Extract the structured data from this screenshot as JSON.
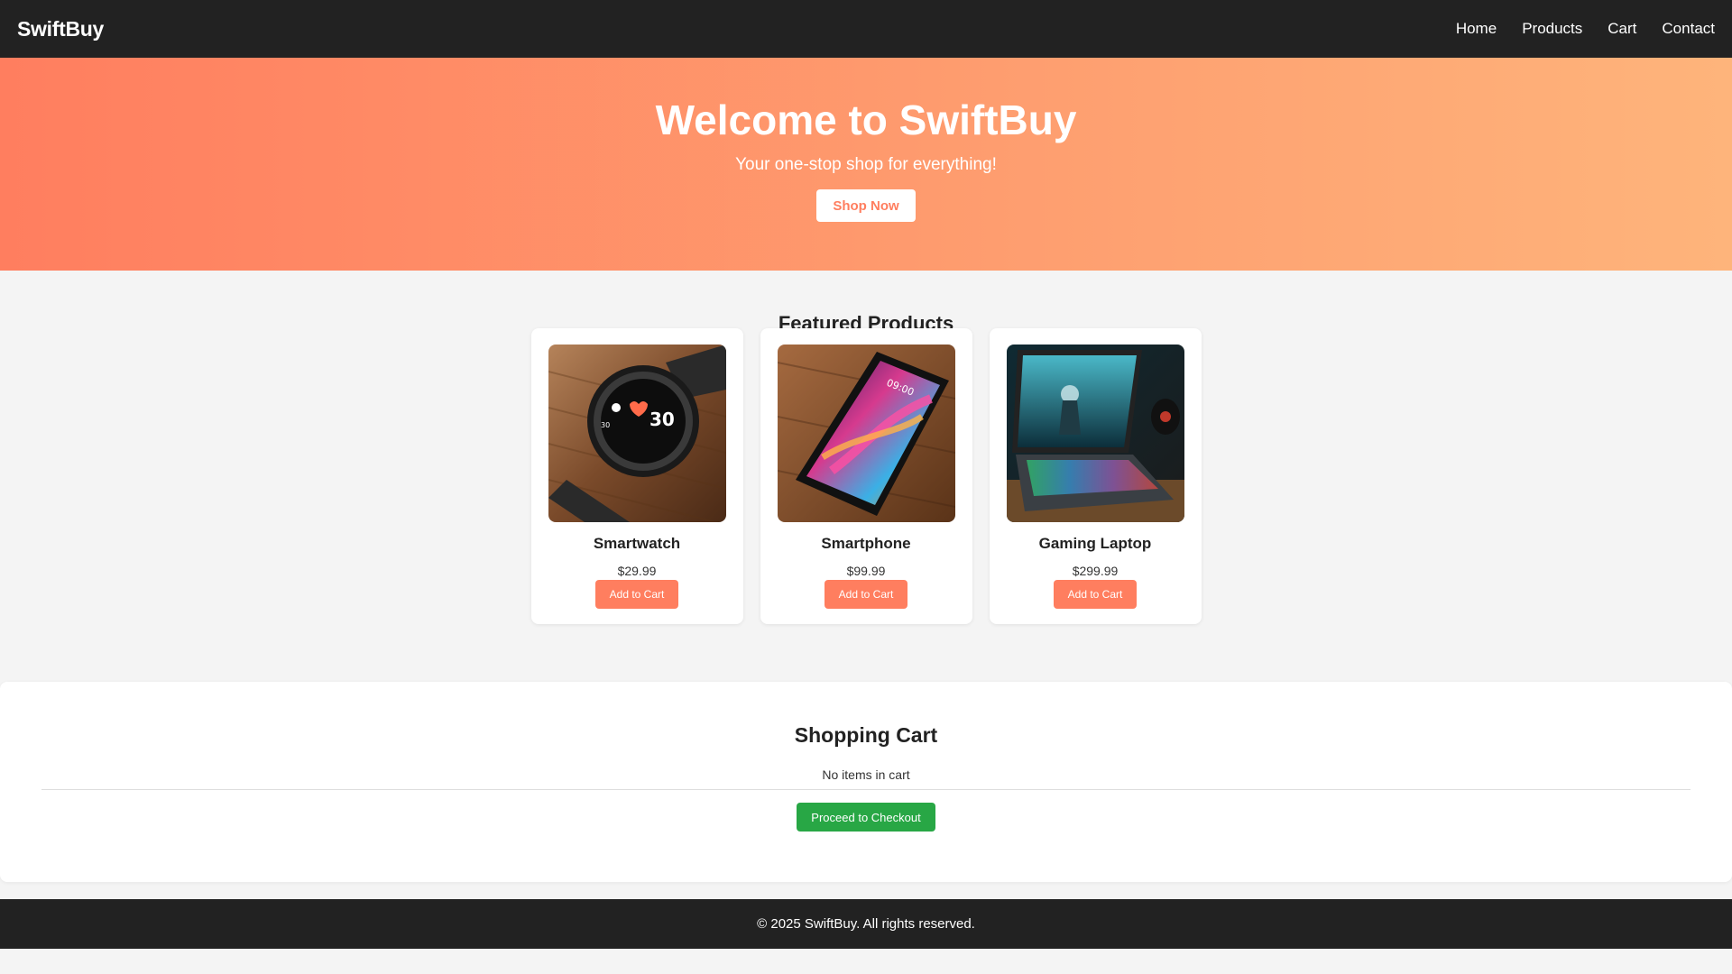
{
  "navbar": {
    "logo": "SwiftBuy",
    "links": [
      {
        "label": "Home"
      },
      {
        "label": "Products"
      },
      {
        "label": "Cart"
      },
      {
        "label": "Contact"
      }
    ]
  },
  "hero": {
    "title": "Welcome to SwiftBuy",
    "subtitle": "Your one-stop shop for everything!",
    "button_label": "Shop Now"
  },
  "products": {
    "title": "Featured Products",
    "items": [
      {
        "name": "Smartwatch",
        "price": "$29.99",
        "button_label": "Add to Cart",
        "image": "smartwatch-image"
      },
      {
        "name": "Smartphone",
        "price": "$99.99",
        "button_label": "Add to Cart",
        "image": "smartphone-image"
      },
      {
        "name": "Gaming Laptop",
        "price": "$299.99",
        "button_label": "Add to Cart",
        "image": "gaming-laptop-image"
      }
    ]
  },
  "cart": {
    "title": "Shopping Cart",
    "empty_text": "No items in cart",
    "checkout_label": "Proceed to Checkout"
  },
  "footer": {
    "text": "© 2025 SwiftBuy. All rights reserved."
  },
  "colors": {
    "nav_bg": "#222222",
    "hero_gradient_start": "#ff7e5f",
    "hero_gradient_end": "#feb47b",
    "accent": "#ff7e5f",
    "checkout": "#28a745",
    "page_bg": "#f4f4f4"
  }
}
